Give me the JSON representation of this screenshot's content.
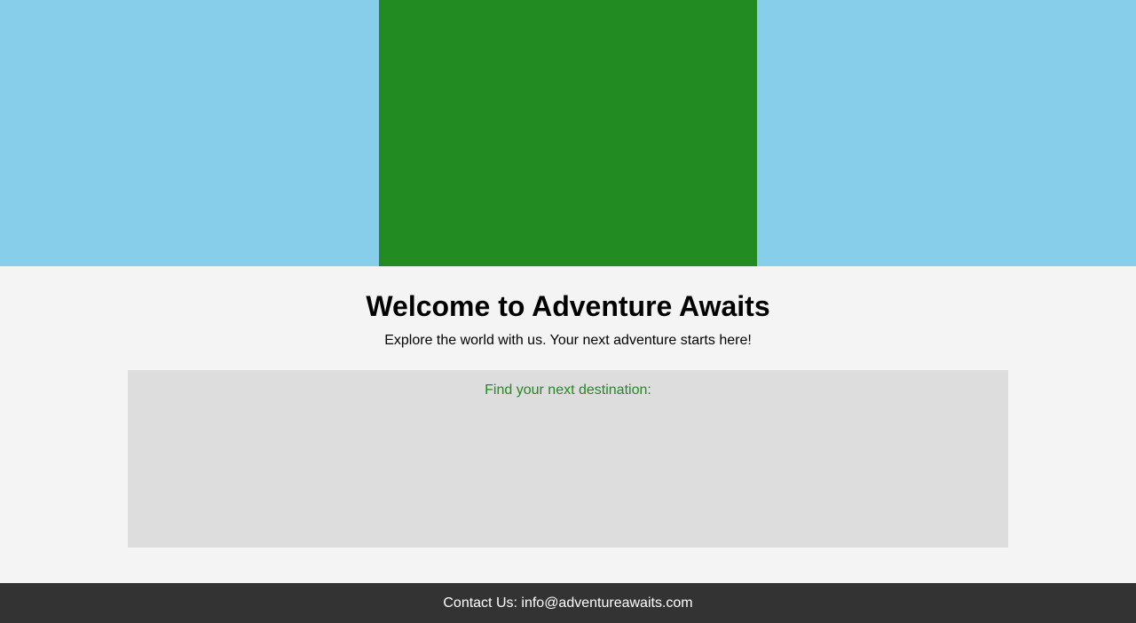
{
  "colors": {
    "sky": "#87ceeb",
    "green": "#228b22",
    "page_background": "#f4f4f4",
    "panel_background": "#dddddd",
    "footer_background": "#333333",
    "footer_text": "#ffffff"
  },
  "main": {
    "title": "Welcome to Adventure Awaits",
    "tagline": "Explore the world with us. Your next adventure starts here!"
  },
  "search": {
    "label": "Find your next destination:"
  },
  "footer": {
    "contact": "Contact Us: info@adventureawaits.com"
  }
}
